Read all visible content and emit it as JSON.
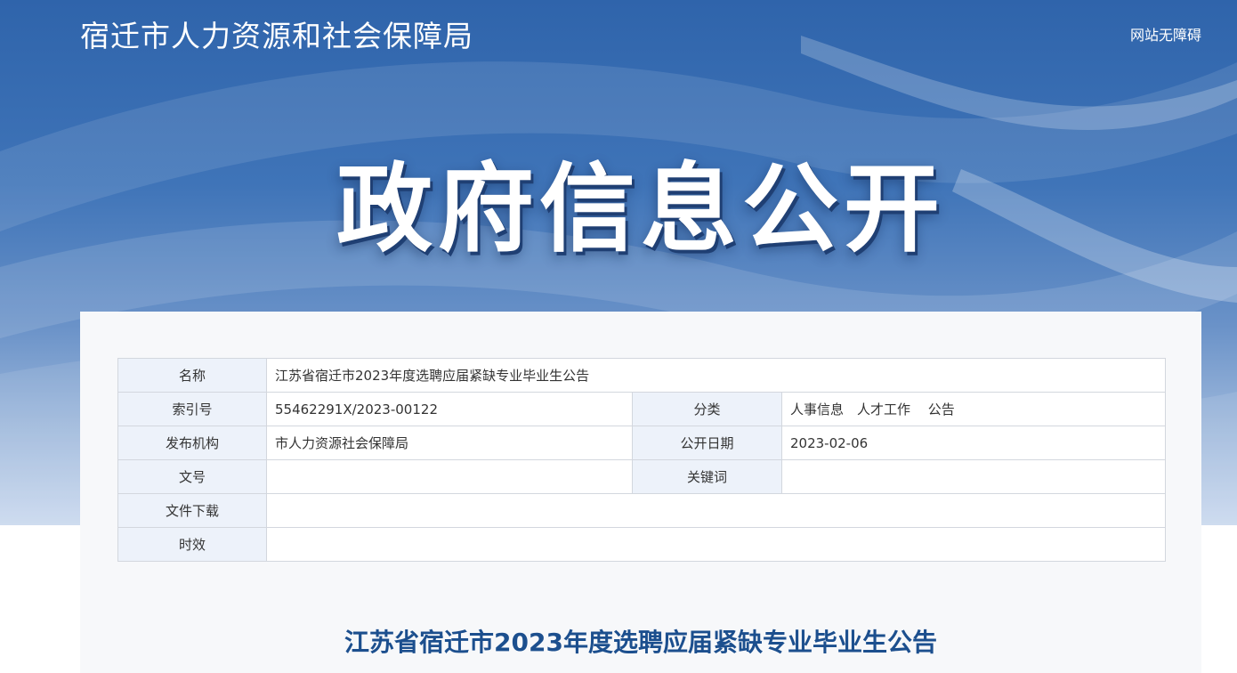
{
  "header": {
    "site_title": "宿迁市人力资源和社会保障局",
    "accessibility": "网站无障碍"
  },
  "hero": {
    "title": "政府信息公开"
  },
  "info_table": {
    "name_label": "名称",
    "name_value": "江苏省宿迁市2023年度选聘应届紧缺专业毕业生公告",
    "index_label": "索引号",
    "index_value": "55462291X/2023-00122",
    "category_label": "分类",
    "category_value": "人事信息　人才工作　 公告",
    "publisher_label": "发布机构",
    "publisher_value": "市人力资源社会保障局",
    "date_label": "公开日期",
    "date_value": "2023-02-06",
    "doc_no_label": "文号",
    "doc_no_value": "",
    "keywords_label": "关键词",
    "keywords_value": "",
    "download_label": "文件下载",
    "download_value": "",
    "validity_label": "时效",
    "validity_value": ""
  },
  "article": {
    "title": "江苏省宿迁市2023年度选聘应届紧缺专业毕业生公告"
  },
  "colors": {
    "banner_top": "#2f64ab",
    "label_bg": "#edf2fa",
    "article_title": "#1c4f8e"
  }
}
